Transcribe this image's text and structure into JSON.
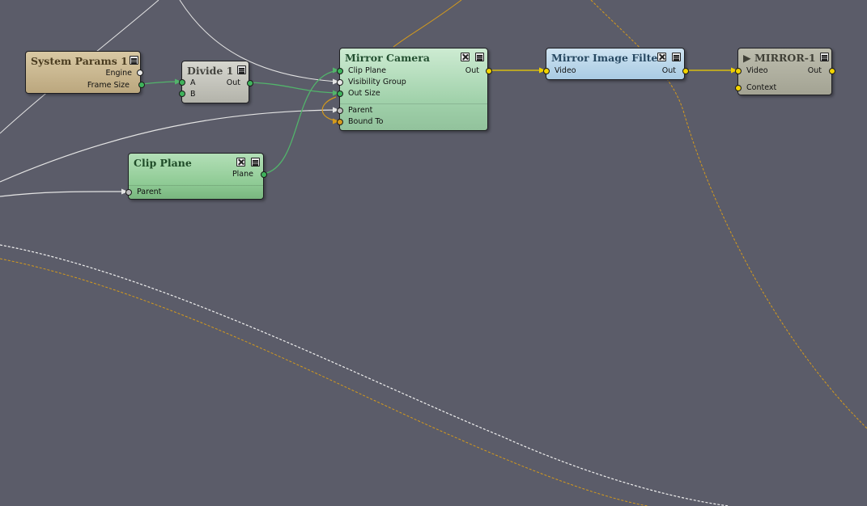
{
  "nodes": {
    "system_params": {
      "title": "System Params 1",
      "outputs": [
        "Engine",
        "Frame Size"
      ]
    },
    "divide": {
      "title": "Divide 1",
      "inputs": [
        "A",
        "B"
      ],
      "output": "Out"
    },
    "mirror_camera": {
      "title": "Mirror Camera",
      "inputs": [
        "Clip Plane",
        "Visibility Group",
        "Out Size"
      ],
      "output": "Out",
      "extras": [
        "Parent",
        "Bound To"
      ]
    },
    "clip_plane": {
      "title": "Clip Plane",
      "output": "Plane",
      "extras": [
        "Parent"
      ]
    },
    "mirror_image_filter": {
      "title": "Mirror Image Filter",
      "input": "Video",
      "output": "Out"
    },
    "mirror_output": {
      "title": "▶ MIRROR-1",
      "input": "Video",
      "output": "Out",
      "extra": "Context"
    }
  },
  "colors": {
    "canvas": "#5b5c69",
    "wire_green": "#52b46b",
    "wire_white": "#e4e4e4",
    "wire_yellow": "#f0d000",
    "wire_orange": "#d49a1c"
  },
  "icons": {
    "close": "close-icon",
    "menu": "menu-icon",
    "play": "play-icon"
  }
}
